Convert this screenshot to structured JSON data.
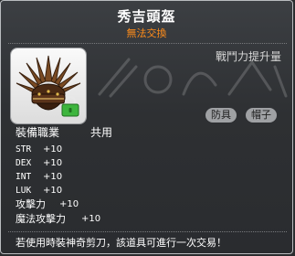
{
  "item": {
    "name": "秀吉頭盔",
    "trade_status": "無法交換",
    "power_label": "戰鬥力提升量",
    "tags": [
      "防具",
      "帽子"
    ],
    "job_label": "裝備職業",
    "job_value": "共用"
  },
  "stats": [
    {
      "name": "STR",
      "value": "+10"
    },
    {
      "name": "DEX",
      "value": "+10"
    },
    {
      "name": "INT",
      "value": "+10"
    },
    {
      "name": "LUK",
      "value": "+10"
    },
    {
      "name": "攻擊力",
      "value": "+10"
    },
    {
      "name": "魔法攻擊力",
      "value": "+10"
    }
  ],
  "note": "若使用時裝神奇剪刀，該道具可進行一次交易！",
  "colors": {
    "title": "#ffffff",
    "trade_status": "#ff8c1a",
    "tag_bg": "#9fa1a4",
    "lock": "#3db53d"
  },
  "icons": {
    "item": "samurai-helmet-icon",
    "lock": "lock-icon"
  }
}
